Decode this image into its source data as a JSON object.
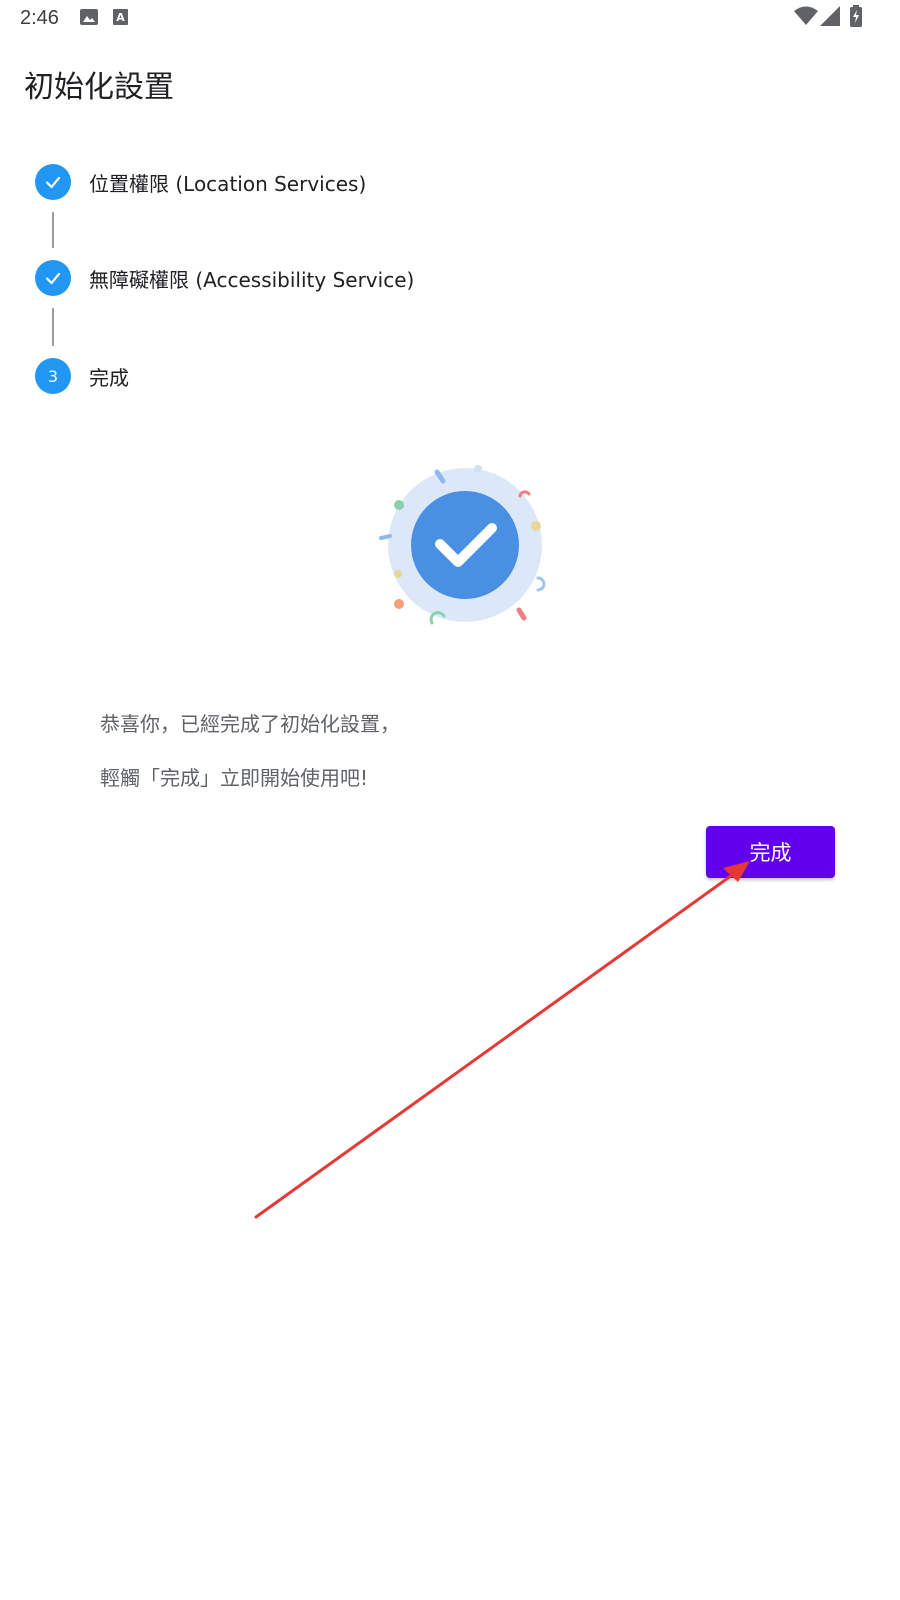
{
  "status_bar": {
    "time": "2:46",
    "left_icons": [
      "image-icon",
      "font-icon"
    ],
    "right_icons": [
      "wifi-icon",
      "signal-icon",
      "battery-charging-icon"
    ]
  },
  "page": {
    "title": "初始化設置"
  },
  "steps": [
    {
      "label": "位置權限 (Location Services)",
      "state": "completed"
    },
    {
      "label": "無障礙權限 (Accessibility Service)",
      "state": "completed"
    },
    {
      "label": "完成",
      "state": "active",
      "number": "3"
    }
  ],
  "message": {
    "line1": "恭喜你，已經完成了初始化設置，",
    "line2": "輕觸「完成」立即開始使用吧!"
  },
  "buttons": {
    "done_label": "完成"
  },
  "colors": {
    "step_circle": "#2196f3",
    "button": "#6200ee",
    "illustration_bg": "#dce8f8",
    "illustration_circle": "#4a90e2",
    "arrow": "#e53935"
  }
}
